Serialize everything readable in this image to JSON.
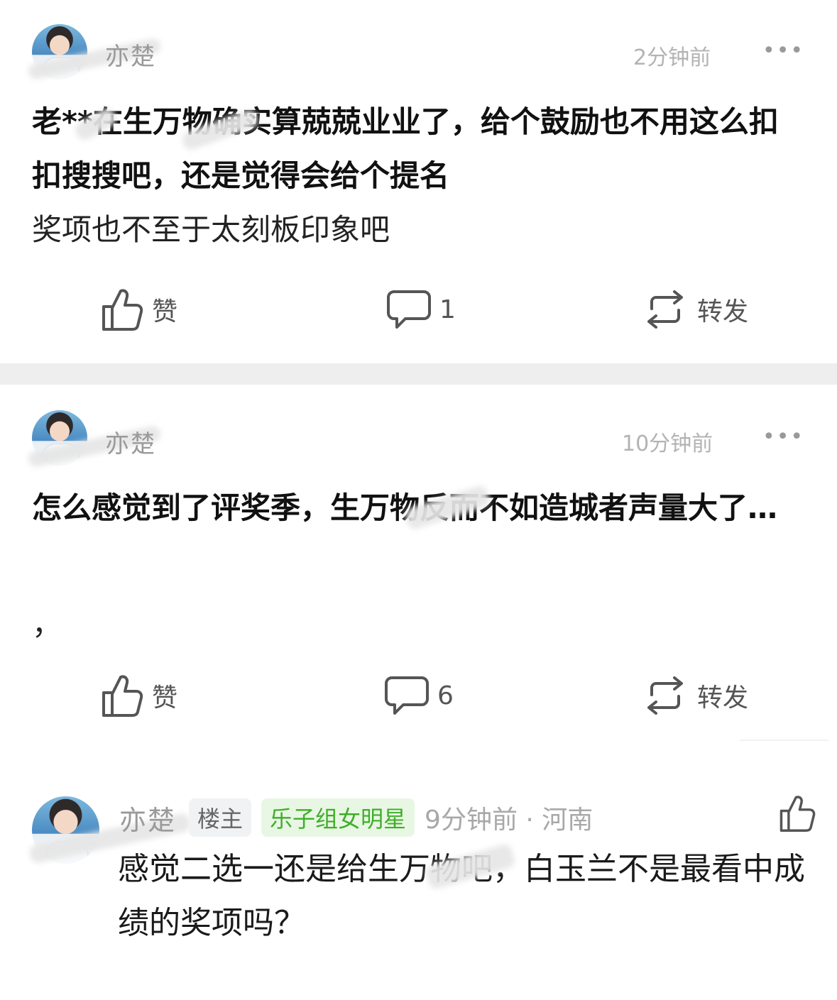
{
  "posts": [
    {
      "username": "亦楚",
      "time": "2分钟前",
      "more": "•••",
      "text_bold": "老**在生万物确实算兢兢业业了，给个鼓励也不用这么扣扣搜搜吧，还是觉得会给个提名",
      "text_light": "奖项也不至于太刻板印象吧",
      "like_label": "赞",
      "comment_count": "1",
      "repost_label": "转发"
    },
    {
      "username": "亦楚",
      "time": "10分钟前",
      "more": "•••",
      "text_bold": "怎么感觉到了评奖季，生万物反而不如造城者声量大了…",
      "text_light": "，",
      "like_label": "赞",
      "comment_count": "6",
      "repost_label": "转发"
    }
  ],
  "comment": {
    "username": "亦楚",
    "badge_owner": "楼主",
    "badge_tag": "乐子组女明星",
    "time_location": "9分钟前 · 河南",
    "text": "感觉二选一还是给生万物吧，白玉兰不是最看中成绩的奖项吗？"
  },
  "icons": {
    "like": "thumbs-up-icon",
    "comment": "speech-bubble-icon",
    "repost": "repost-arrows-icon",
    "more": "more-dots-icon"
  },
  "colors": {
    "badge_green_text": "#3fae29",
    "badge_green_bg": "#e8f7e3",
    "separator": "#eeeeee"
  }
}
